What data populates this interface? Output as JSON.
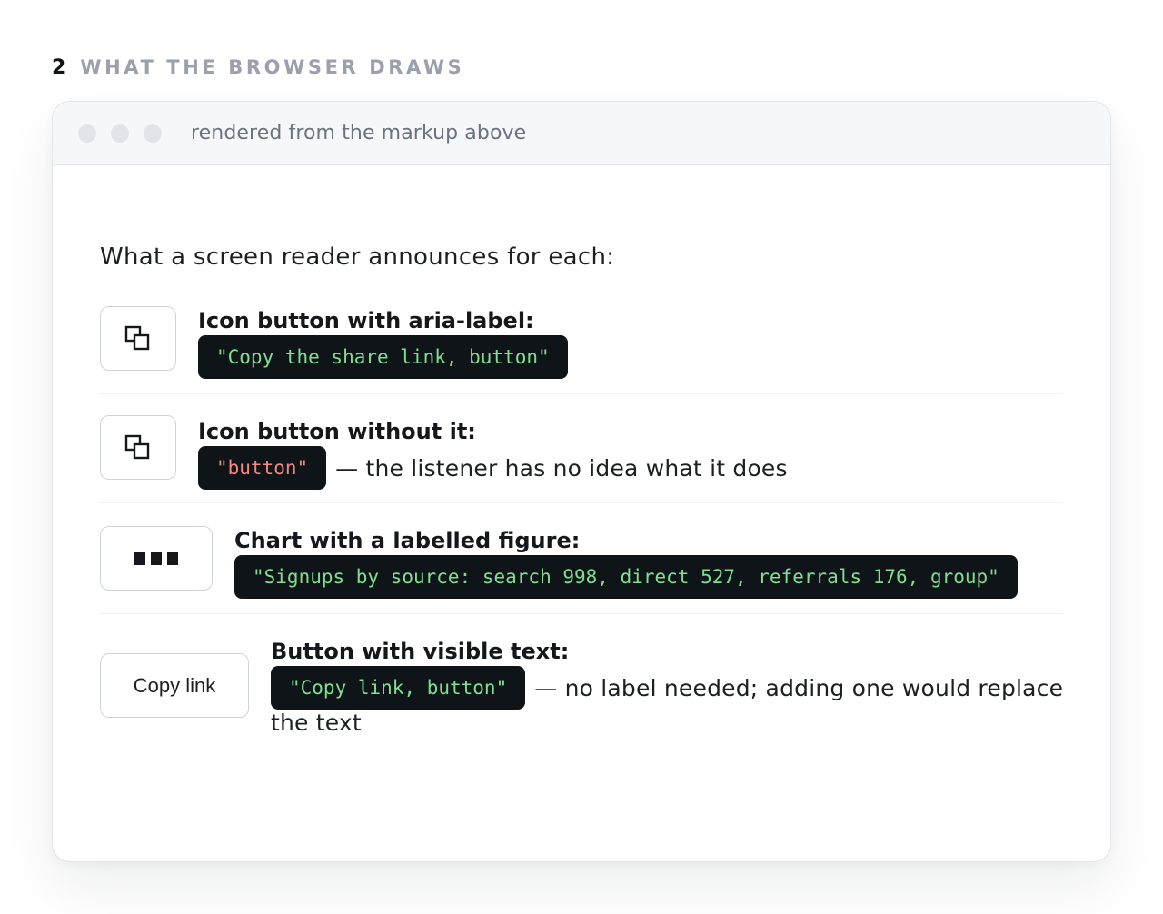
{
  "section": {
    "number": "2",
    "title": "WHAT THE BROWSER DRAWS"
  },
  "window": {
    "caption": "rendered from the markup above"
  },
  "intro": "What a screen reader announces for each:",
  "rows": [
    {
      "preview_icon": "copy-icon",
      "label": "Icon button with aria-label:",
      "announcement": "\"Copy the share link, button\"",
      "note": ""
    },
    {
      "preview_icon": "copy-icon",
      "label": "Icon button without it:",
      "announcement": "\"button\"",
      "note": "— the listener has no idea what it does"
    },
    {
      "preview_icon": "bar-chart-icon",
      "label": "Chart with a labelled figure:",
      "announcement": "\"Signups by source: search 998, direct 527, referrals 176, group\"",
      "note": ""
    },
    {
      "preview_text": "Copy link",
      "label": "Button with visible text:",
      "announcement": "\"Copy link, button\"",
      "note_first": "— no label needed; adding one would replace",
      "note_second": "the text"
    }
  ],
  "colors": {
    "good_announcement": "#7ee08f",
    "bad_announcement": "#f08a7e",
    "chip_background": "#0f1419"
  }
}
